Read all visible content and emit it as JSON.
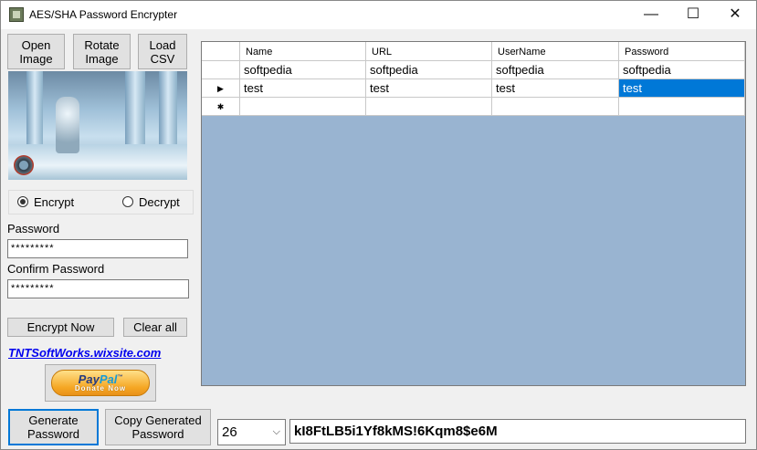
{
  "window": {
    "title": "AES/SHA Password Encrypter",
    "minimize": "—",
    "maximize": "☐",
    "close": "✕"
  },
  "toolbar": {
    "open_image": "Open\nImage",
    "rotate_image": "Rotate\nImage",
    "load_csv": "Load\nCSV"
  },
  "mode": {
    "encrypt_label": "Encrypt",
    "decrypt_label": "Decrypt",
    "selected": "encrypt"
  },
  "fields": {
    "password_label": "Password",
    "password_value": "*********",
    "confirm_label": "Confirm Password",
    "confirm_value": "*********"
  },
  "actions": {
    "encrypt_now": "Encrypt Now",
    "clear_all": "Clear all"
  },
  "link": {
    "text": "TNTSoftWorks.wixsite.com"
  },
  "paypal": {
    "logo_pay": "Pay",
    "logo_pal": "Pal",
    "tm": "™",
    "donate": "Donate Now"
  },
  "grid": {
    "columns": [
      "Name",
      "URL",
      "UserName",
      "Password"
    ],
    "rows": [
      {
        "marker": "",
        "cells": [
          "softpedia",
          "softpedia",
          "softpedia",
          "softpedia"
        ]
      },
      {
        "marker": "▶",
        "cells": [
          "test",
          "test",
          "test",
          "test"
        ]
      },
      {
        "marker": "✱",
        "cells": [
          "",
          "",
          "",
          ""
        ]
      }
    ]
  },
  "generator": {
    "generate": "Generate\nPassword",
    "copy": "Copy Generated\nPassword",
    "length": "26",
    "dropdown_arrow": "⌵",
    "output": "kI8FtLB5i1Yf8kMS!6Kqm8$e6M"
  },
  "colors": {
    "selection": "#0078d7",
    "grid_background": "#99b4d1",
    "link": "#0000ee"
  }
}
